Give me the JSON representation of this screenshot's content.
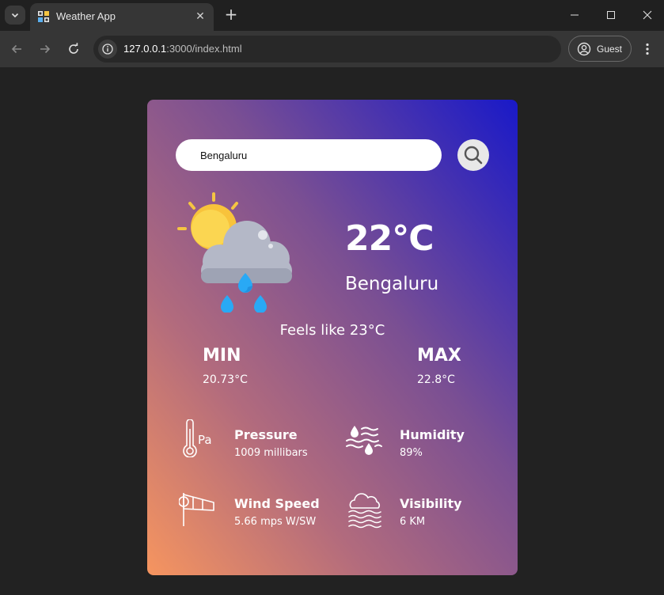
{
  "browser": {
    "tab_title": "Weather App",
    "url_host": "127.0.0.1",
    "url_path": ":3000/index.html",
    "profile_label": "Guest"
  },
  "weather": {
    "search_value": "Bengaluru",
    "temperature": "22°C",
    "city": "Bengaluru",
    "feels_like": "Feels like 23°C",
    "min_label": "MIN",
    "min_value": "20.73°C",
    "max_label": "MAX",
    "max_value": "22.8°C",
    "condition_icon": "sun-cloud-rain-icon",
    "stats": {
      "pressure": {
        "label": "Pressure",
        "value": "1009 millibars",
        "icon": "pressure-thermometer-icon"
      },
      "humidity": {
        "label": "Humidity",
        "value": "89%",
        "icon": "humidity-icon"
      },
      "wind": {
        "label": "Wind Speed",
        "value": "5.66 mps W/SW",
        "icon": "windsock-icon"
      },
      "visibility": {
        "label": "Visibility",
        "value": "6 KM",
        "icon": "fog-cloud-icon"
      }
    }
  },
  "colors": {
    "gradient_start": "#f6955f",
    "gradient_end": "#1919c8",
    "browser_frame": "#202020",
    "toolbar": "#363636"
  }
}
